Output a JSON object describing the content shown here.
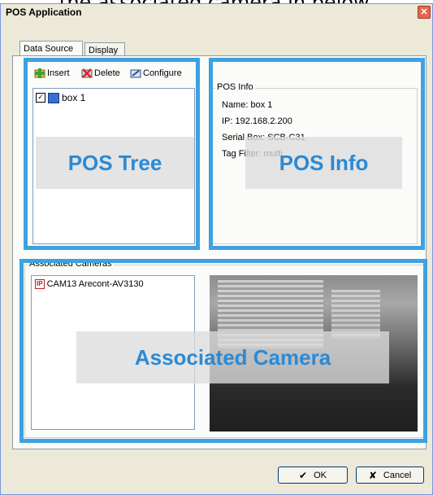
{
  "caption": "the associated camera in below.",
  "window": {
    "title": "POS Application",
    "close_glyph": "✕"
  },
  "tabs": [
    {
      "label": "Data Source",
      "active": true
    },
    {
      "label": "Display",
      "active": false
    }
  ],
  "toolbar": {
    "insert_label": "Insert",
    "delete_label": "Delete",
    "configure_label": "Configure"
  },
  "pos_tree": {
    "items": [
      {
        "label": "box 1",
        "checked": true
      }
    ]
  },
  "pos_info": {
    "group_label": "POS Info",
    "name": "Name: box 1",
    "ip": "IP: 192.168.2.200",
    "serial_box": "Serial Box: SCB-C31",
    "tag_filter": "Tag Filter: multi"
  },
  "associated_cameras": {
    "group_label": "Associated Cameras",
    "items": [
      {
        "label": "CAM13 Arecont-AV3130",
        "badge": "IP"
      }
    ]
  },
  "overlays": {
    "pos_tree": "POS Tree",
    "pos_info": "POS Info",
    "associated_camera": "Associated Camera"
  },
  "buttons": {
    "ok_label": "OK",
    "ok_glyph": "✔",
    "cancel_label": "Cancel",
    "cancel_glyph": "✘"
  },
  "colors": {
    "highlight": "#3da1e3",
    "overlay_text": "#2a8ad6"
  }
}
